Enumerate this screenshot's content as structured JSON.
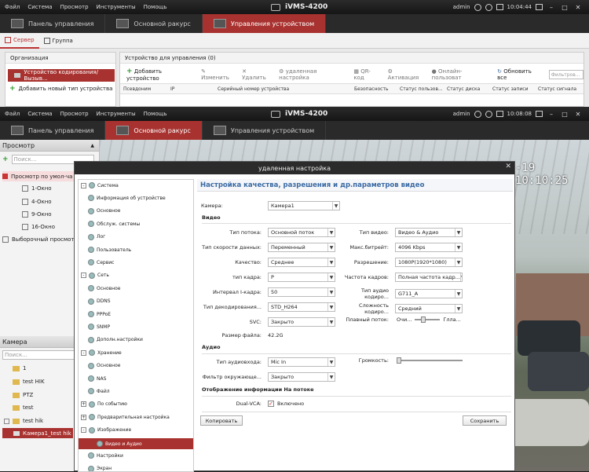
{
  "top_window": {
    "menu": [
      "Файл",
      "Система",
      "Просмотр",
      "Инструменты",
      "Помощь"
    ],
    "title": "iVMS-4200",
    "user": "admin",
    "time": "10:04:44",
    "tabs": [
      "Панель управления",
      "Основной ракурс",
      "Управления устройством"
    ],
    "subtabs": [
      "Сервер",
      "Группа"
    ],
    "org_header": "Организация",
    "org_selected": "Устройство кодирования/Вызыв...",
    "org_add": "Добавить новый тип устройства",
    "devices_header": "Устройство для управления (0)",
    "toolbar": [
      "Добавить устройство",
      "Изменить",
      "Удалить",
      "удаленная настройка",
      "QR-код",
      "Активация",
      "Онлайн-пользоват",
      "Обновить все"
    ],
    "filter_placeholder": "Фильтров...",
    "columns": [
      "Псевдоним",
      "IP",
      "Серийный номер устройства",
      "Безопасность",
      "Статус пользов...",
      "Статус диска",
      "Статус записи",
      "Статус сигнала"
    ]
  },
  "bottom_window": {
    "menu": [
      "Файл",
      "Система",
      "Просмотр",
      "Инструменты",
      "Помощь"
    ],
    "title": "iVMS-4200",
    "user": "admin",
    "time": "10:08:08",
    "tabs": [
      "Панель управления",
      "Основной ракурс",
      "Управления устройством"
    ],
    "view_header": "Просмотр",
    "search_placeholder": "Поиск...",
    "view_items": [
      "Просмотр по умол-ча",
      "1-Окно",
      "4-Окно",
      "9-Окно",
      "16-Окно",
      "Выборочный просмот"
    ],
    "camera_header": "Камера",
    "camera_items": [
      "1",
      "test HIK",
      "PTZ",
      "test",
      "test hik",
      "Камера1_test hik"
    ],
    "osd_time": "-19 10:10:25"
  },
  "dialog": {
    "title": "удаленная настройка",
    "heading": "Настройка качества, разрешения и др.параметров видео",
    "tree": [
      {
        "label": "Система",
        "level": 0,
        "box": "-"
      },
      {
        "label": "Информация об устройстве",
        "level": 1
      },
      {
        "label": "Основное",
        "level": 1
      },
      {
        "label": "Обслуж. системы",
        "level": 1
      },
      {
        "label": "Лог",
        "level": 1
      },
      {
        "label": "Пользователь",
        "level": 1
      },
      {
        "label": "Сервис",
        "level": 1
      },
      {
        "label": "Сеть",
        "level": 0,
        "box": "-"
      },
      {
        "label": "Основное",
        "level": 1
      },
      {
        "label": "DDNS",
        "level": 1
      },
      {
        "label": "PPPoE",
        "level": 1
      },
      {
        "label": "SNMP",
        "level": 1
      },
      {
        "label": "Дополн.настройки",
        "level": 1
      },
      {
        "label": "Хранение",
        "level": 0,
        "box": "-"
      },
      {
        "label": "Основное",
        "level": 1
      },
      {
        "label": "NAS",
        "level": 1
      },
      {
        "label": "Файл",
        "level": 1
      },
      {
        "label": "По событию",
        "level": 0,
        "box": "+"
      },
      {
        "label": "Предварительная настройка",
        "level": 0,
        "box": "+"
      },
      {
        "label": "Изображение",
        "level": 0,
        "box": "-"
      },
      {
        "label": "Видео и Аудио",
        "level": 1,
        "selected": true
      },
      {
        "label": "Настройки",
        "level": 1
      },
      {
        "label": "Экран",
        "level": 1
      }
    ],
    "camera_label": "Камера:",
    "camera_value": "Камера1",
    "video_section": "Видео",
    "left_fields": [
      {
        "label": "Тип потока:",
        "value": "Основной поток"
      },
      {
        "label": "Тип скорости данных:",
        "value": "Переменный"
      },
      {
        "label": "Качество:",
        "value": "Среднее"
      },
      {
        "label": "тип кадра:",
        "value": "P"
      },
      {
        "label": "Интервал I-кадра:",
        "value": "50"
      },
      {
        "label": "Тип декодирования...",
        "value": "STD_H264"
      },
      {
        "label": "SVC:",
        "value": "Закрыто"
      }
    ],
    "right_fields": [
      {
        "label": "Тип видео:",
        "value": "Видео & Аудио"
      },
      {
        "label": "Макс.битрейт:",
        "value": "4096 Kbps"
      },
      {
        "label": "Разрешение:",
        "value": "1080P(1920*1080)"
      },
      {
        "label": "Частота кадров:",
        "value": "Полная частота кадр..."
      },
      {
        "label": "Тип аудио кодиро...",
        "value": "G711_A"
      },
      {
        "label": "Сложность кодиро...",
        "value": "Средний"
      }
    ],
    "smooth_label": "Плавный поток:",
    "smooth_left": "Очи...",
    "smooth_right": "Глла...",
    "file_size_label": "Размер файла:",
    "file_size_value": "42.2G",
    "audio_section": "Аудио",
    "audio_input_label": "Тип аудиовхода:",
    "audio_input_value": "Mic In",
    "volume_label": "Громкость:",
    "env_filter_label": "Фильтр окружающе...",
    "env_filter_value": "Закрыто",
    "osd_section": "Отображение информации На потоке",
    "dualvca_label": "Dual-VCA:",
    "dualvca_value": "Включено",
    "copy_button": "Копировать",
    "save_button": "Сохранить"
  }
}
